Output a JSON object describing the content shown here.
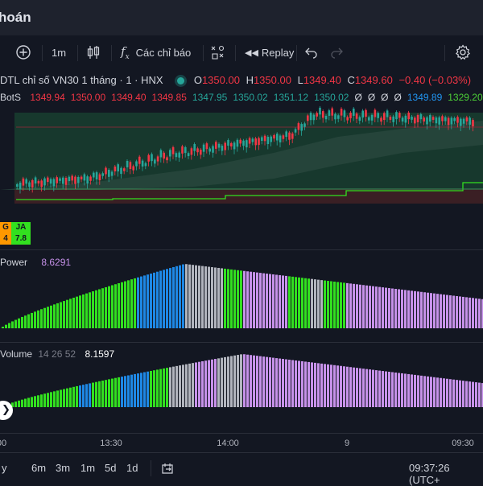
{
  "app": {
    "title": "hoán"
  },
  "toolbar": {
    "interval": "1m",
    "indicators_label": "Các chỉ báo",
    "replay_label": "Replay"
  },
  "legend": {
    "symbol": "DTL chỉ số VN30 1 tháng · 1 · HNX",
    "o_label": "O",
    "o_value": "1350.00",
    "h_label": "H",
    "h_value": "1350.00",
    "l_label": "L",
    "l_value": "1349.40",
    "c_label": "C",
    "c_value": "1349.60",
    "change": "−0.40 (−0.03%)",
    "indicator_name": "BotS",
    "values": [
      {
        "text": "1349.94",
        "color": "#f23645"
      },
      {
        "text": "1350.00",
        "color": "#f23645"
      },
      {
        "text": "1349.40",
        "color": "#f23645"
      },
      {
        "text": "1349.85",
        "color": "#f23645"
      },
      {
        "text": "1347.95",
        "color": "#26a69a"
      },
      {
        "text": "1350.02",
        "color": "#26a69a"
      },
      {
        "text": "1351.12",
        "color": "#26a69a"
      },
      {
        "text": "1350.02",
        "color": "#26a69a"
      },
      {
        "text": "Ø",
        "color": "#d1d4dc"
      },
      {
        "text": "Ø",
        "color": "#d1d4dc"
      },
      {
        "text": "Ø",
        "color": "#d1d4dc"
      },
      {
        "text": "Ø",
        "color": "#d1d4dc"
      },
      {
        "text": "1349.89",
        "color": "#2196f3"
      },
      {
        "text": "1329.20",
        "color": "#4cd137"
      }
    ]
  },
  "badges": {
    "left_top": "G",
    "left_bottom": "4",
    "right_top": "JA",
    "right_bottom": "7.8"
  },
  "panes": {
    "power": {
      "name": "Power",
      "value": "8.6291"
    },
    "volume": {
      "name": "Volume",
      "params": "14 26 52",
      "value": "8.1597"
    }
  },
  "time_axis": {
    "labels": [
      "00",
      "13:30",
      "14:00",
      "9",
      "09:30"
    ]
  },
  "bottom_bar": {
    "ranges": [
      "y",
      "6m",
      "3m",
      "1m",
      "5d",
      "1d"
    ],
    "clock": "09:37:26 (UTC+"
  },
  "colors": {
    "up": "#26a69a",
    "down": "#f23645",
    "bar_green": "#32e01f",
    "bar_blue": "#1e88e5",
    "bar_grey": "#b2b5be",
    "bar_violet": "#c792ea"
  }
}
